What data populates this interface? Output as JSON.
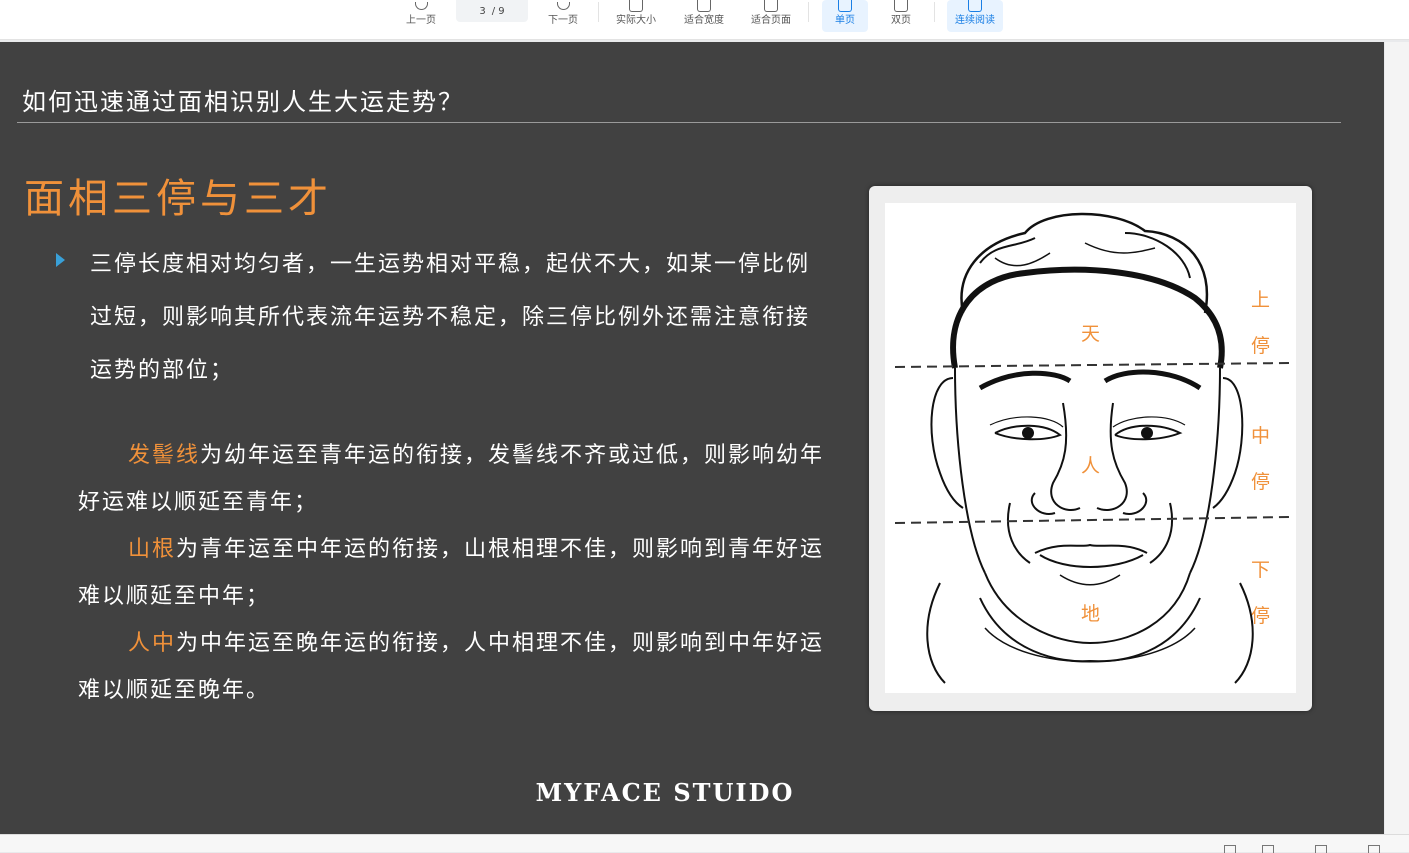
{
  "toolbar": {
    "prev_label": "上一页",
    "page_current": "3",
    "page_total": "/ 9",
    "next_label": "下一页",
    "actual_size_label": "实际大小",
    "fit_width_label": "适合宽度",
    "fit_page_label": "适合页面",
    "single_page_label": "单页",
    "double_page_label": "双页",
    "continuous_label": "连续阅读"
  },
  "slide": {
    "title": "如何迅速通过面相识别人生大运走势？",
    "heading": "面相三停与三才",
    "bullet_text": "三停长度相对均匀者，一生运势相对平稳，起伏不大，如某一停比例过短，则影响其所代表流年运势不稳定，除三停比例外还需注意衔接运势的部位；",
    "items": [
      {
        "key": "发髻线",
        "text": "为幼年运至青年运的衔接，发髻线不齐或过低，则影响幼年好运难以顺延至青年；"
      },
      {
        "key": "山根",
        "text": "为青年运至中年运的衔接，山根相理不佳，则影响到青年好运难以顺延至中年；"
      },
      {
        "key": "人中",
        "text": "为中年运至晚年运的衔接，人中相理不佳，则影响到中年好运难以顺延至晚年。"
      }
    ],
    "footer": "MYFACE STUIDO"
  },
  "figure": {
    "label_tian": "天",
    "label_ren": "人",
    "label_di": "地",
    "upper_1": "上",
    "upper_2": "停",
    "middle_1": "中",
    "middle_2": "停",
    "lower_1": "下",
    "lower_2": "停"
  },
  "colors": {
    "slide_bg": "#414141",
    "accent_orange": "#f0913a",
    "bullet_blue": "#39a0d8",
    "active_blue": "#1a7fe5"
  }
}
